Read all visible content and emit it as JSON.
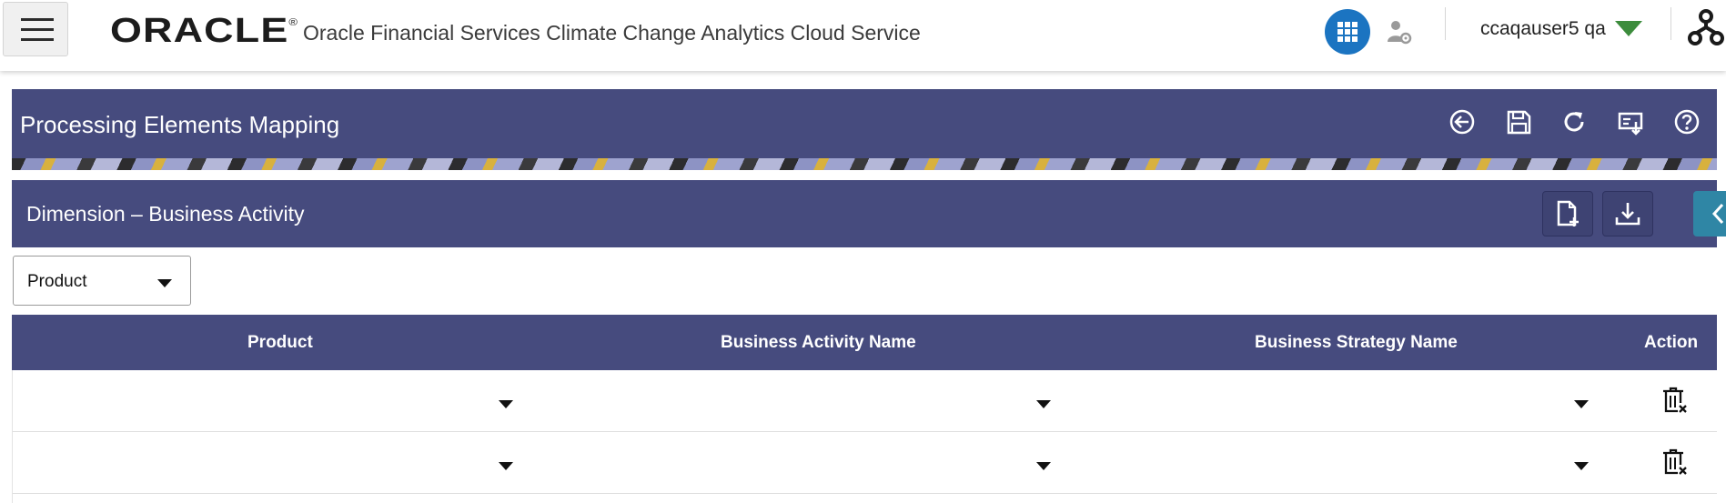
{
  "topbar": {
    "brand": "ORACLE",
    "brand_mark": "®",
    "app_title": "Oracle Financial Services Climate Change Analytics Cloud Service",
    "user_name": "ccaqauser5 qa",
    "icons": [
      "menu-icon",
      "apps-grid-icon",
      "user-settings-icon",
      "caret-down-icon",
      "hierarchy-icon"
    ]
  },
  "page": {
    "title": "Processing Elements Mapping",
    "actions": [
      "back-icon",
      "save-icon",
      "refresh-icon",
      "export-icon",
      "help-icon"
    ]
  },
  "dimension": {
    "title": "Dimension – Business Activity",
    "buttons": [
      "add-file-icon",
      "download-icon",
      "collapse-icon"
    ]
  },
  "filter": {
    "selected": "Product"
  },
  "table": {
    "columns": [
      "Product",
      "Business Activity Name",
      "Business Strategy Name",
      "Action"
    ],
    "rows": [
      {
        "product": "",
        "business_activity": "",
        "business_strategy": ""
      },
      {
        "product": "",
        "business_activity": "",
        "business_strategy": ""
      }
    ]
  },
  "colors": {
    "header_bg": "#464b7e",
    "accent_button": "#2f86a5",
    "apps_button": "#1b74c1",
    "user_caret": "#3c8c3c"
  }
}
